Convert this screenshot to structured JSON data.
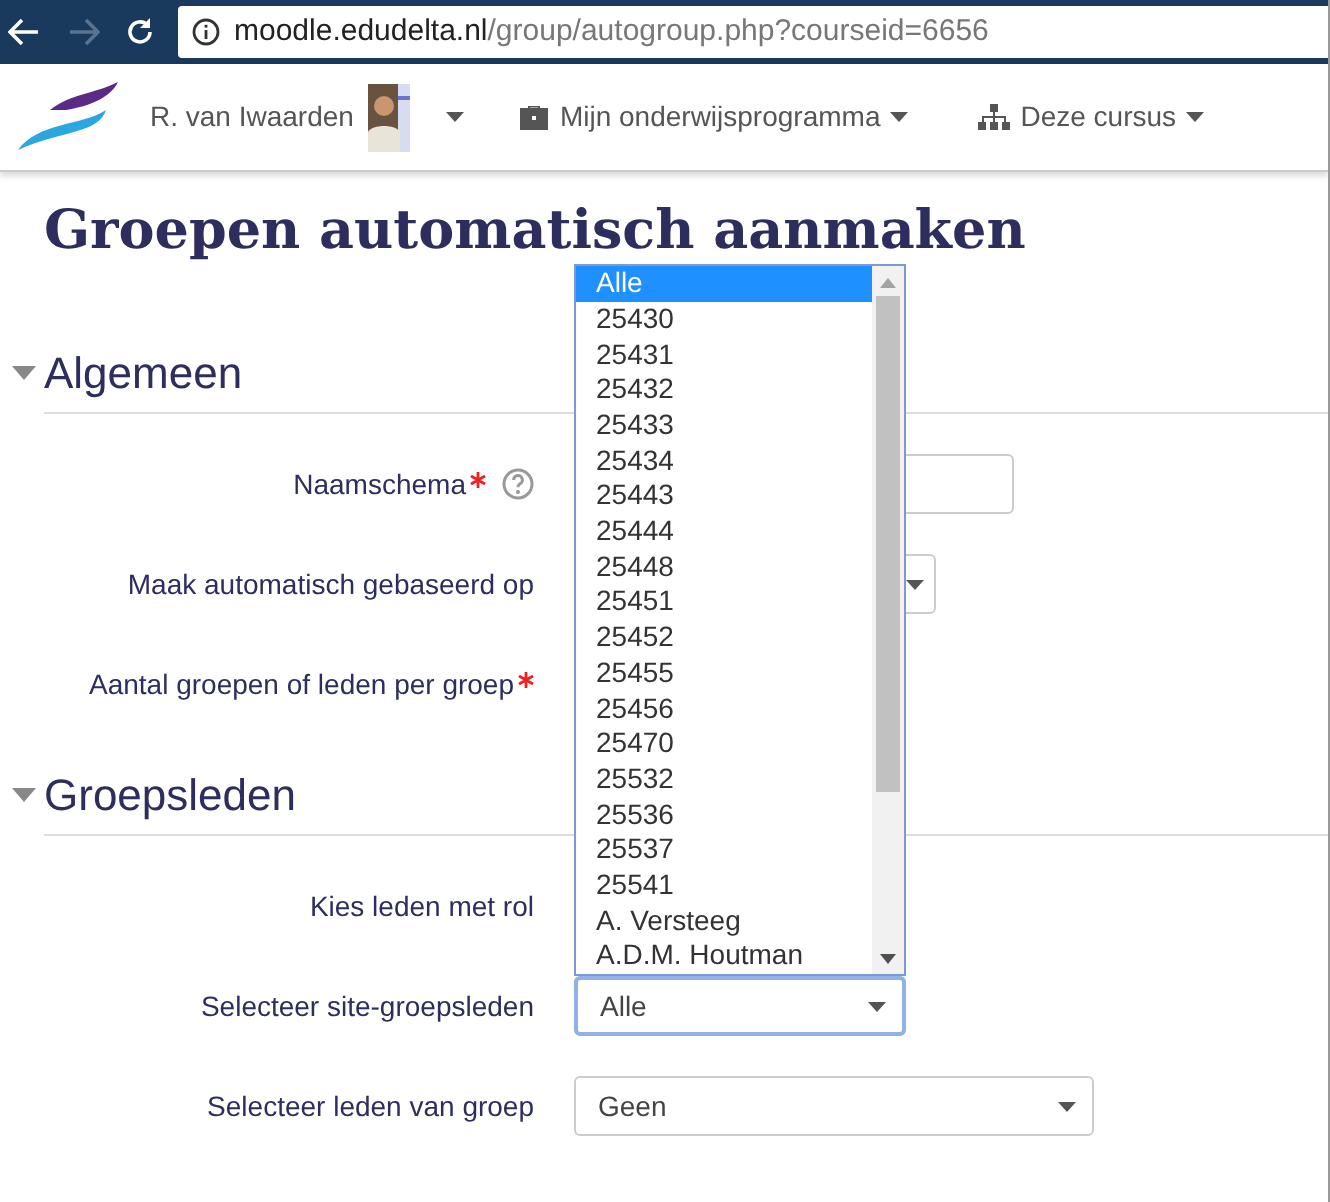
{
  "browser": {
    "url_host": "moodle.edudelta.nl",
    "url_path": "/group/autogroup.php?courseid=6656"
  },
  "navbar": {
    "user": "R. van Iwaarden",
    "menus": [
      {
        "label": "Mijn onderwijsprogramma",
        "kind": "briefcase"
      },
      {
        "label": "Deze cursus",
        "kind": "sitemap"
      }
    ]
  },
  "title": "Groepen automatisch aanmaken",
  "sections": [
    {
      "title": "Algemeen",
      "expanded": true,
      "fields": [
        {
          "label": "Naamschema",
          "required": true,
          "help": true,
          "kind": "text"
        },
        {
          "label": "Maak automatisch gebaseerd op",
          "required": false,
          "help": false,
          "kind": "select"
        },
        {
          "label": "Aantal groepen of leden per groep",
          "required": true,
          "help": false,
          "kind": "covered"
        }
      ]
    },
    {
      "title": "Groepsleden",
      "expanded": true,
      "fields": [
        {
          "label": "Kies leden met rol",
          "required": false,
          "help": false,
          "kind": "covered"
        },
        {
          "label": "Selecteer site-groepsleden",
          "required": false,
          "help": false,
          "kind": "select",
          "value": "Alle",
          "open": true,
          "options": [
            {
              "label": "Alle",
              "selected": true
            },
            {
              "label": "25430",
              "selected": false
            },
            {
              "label": "25431",
              "selected": false
            },
            {
              "label": "25432",
              "selected": false
            },
            {
              "label": "25433",
              "selected": false
            },
            {
              "label": "25434",
              "selected": false
            },
            {
              "label": "25443",
              "selected": false
            },
            {
              "label": "25444",
              "selected": false
            },
            {
              "label": "25448",
              "selected": false
            },
            {
              "label": "25451",
              "selected": false
            },
            {
              "label": "25452",
              "selected": false
            },
            {
              "label": "25455",
              "selected": false
            },
            {
              "label": "25456",
              "selected": false
            },
            {
              "label": "25470",
              "selected": false
            },
            {
              "label": "25532",
              "selected": false
            },
            {
              "label": "25536",
              "selected": false
            },
            {
              "label": "25537",
              "selected": false
            },
            {
              "label": "25541",
              "selected": false
            },
            {
              "label": "A. Versteeg",
              "selected": false
            },
            {
              "label": "A.D.M. Houtman",
              "selected": false
            }
          ]
        },
        {
          "label": "Selecteer leden van groep",
          "required": false,
          "help": false,
          "kind": "select",
          "value": "Geen",
          "wide": true
        }
      ]
    }
  ]
}
